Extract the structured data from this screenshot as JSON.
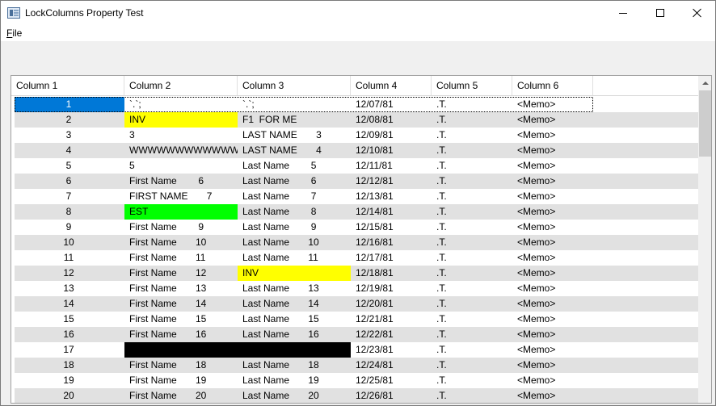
{
  "window": {
    "title": "LockColumns Property Test",
    "menu": [
      {
        "label": "File",
        "accelerator": "F",
        "rest": "ile"
      }
    ]
  },
  "grid": {
    "columns": [
      "Column 1",
      "Column 2",
      "Column 3",
      "Column 4",
      "Column 5",
      "Column 6"
    ],
    "highlight_colors": {
      "yellow": "#ffff00",
      "green": "#00ff00",
      "black": "#000000",
      "selection": "#0078d7"
    },
    "rows": [
      {
        "c1": "1",
        "c2": "`.`;",
        "c3": "`.`;",
        "c4": "12/07/81",
        "c5": ".T.",
        "c6": "<Memo>",
        "selected": true
      },
      {
        "c1": "2",
        "c2": "INV",
        "c3": "F1  FOR ME",
        "c4": "12/08/81",
        "c5": ".T.",
        "c6": "<Memo>",
        "c2_bg": "yellow"
      },
      {
        "c1": "3",
        "c2": "3",
        "c3": "LAST NAME       3",
        "c4": "12/09/81",
        "c5": ".T.",
        "c6": "<Memo>"
      },
      {
        "c1": "4",
        "c2": "WWWWWWWWWWWW...",
        "c3": "LAST NAME       4",
        "c4": "12/10/81",
        "c5": ".T.",
        "c6": "<Memo>"
      },
      {
        "c1": "5",
        "c2": "5",
        "c3": "Last Name        5",
        "c4": "12/11/81",
        "c5": ".T.",
        "c6": "<Memo>"
      },
      {
        "c1": "6",
        "c2": "First Name        6",
        "c3": "Last Name        6",
        "c4": "12/12/81",
        "c5": ".T.",
        "c6": "<Memo>"
      },
      {
        "c1": "7",
        "c2": "FIRST NAME       7",
        "c3": "Last Name        7",
        "c4": "12/13/81",
        "c5": ".T.",
        "c6": "<Memo>"
      },
      {
        "c1": "8",
        "c2": "EST",
        "c3": "Last Name        8",
        "c4": "12/14/81",
        "c5": ".T.",
        "c6": "<Memo>",
        "c2_bg": "green"
      },
      {
        "c1": "9",
        "c2": "First Name        9",
        "c3": "Last Name        9",
        "c4": "12/15/81",
        "c5": ".T.",
        "c6": "<Memo>"
      },
      {
        "c1": "10",
        "c2": "First Name       10",
        "c3": "Last Name       10",
        "c4": "12/16/81",
        "c5": ".T.",
        "c6": "<Memo>"
      },
      {
        "c1": "11",
        "c2": "First Name       11",
        "c3": "Last Name       11",
        "c4": "12/17/81",
        "c5": ".T.",
        "c6": "<Memo>"
      },
      {
        "c1": "12",
        "c2": "First Name       12",
        "c3": "INV",
        "c4": "12/18/81",
        "c5": ".T.",
        "c6": "<Memo>",
        "c3_bg": "yellow"
      },
      {
        "c1": "13",
        "c2": "First Name       13",
        "c3": "Last Name       13",
        "c4": "12/19/81",
        "c5": ".T.",
        "c6": "<Memo>"
      },
      {
        "c1": "14",
        "c2": "First Name       14",
        "c3": "Last Name       14",
        "c4": "12/20/81",
        "c5": ".T.",
        "c6": "<Memo>"
      },
      {
        "c1": "15",
        "c2": "First Name       15",
        "c3": "Last Name       15",
        "c4": "12/21/81",
        "c5": ".T.",
        "c6": "<Memo>"
      },
      {
        "c1": "16",
        "c2": "First Name       16",
        "c3": "Last Name       16",
        "c4": "12/22/81",
        "c5": ".T.",
        "c6": "<Memo>"
      },
      {
        "c1": "17",
        "c2": "",
        "c3": "",
        "c4": "12/23/81",
        "c5": ".T.",
        "c6": "<Memo>",
        "c2_bg": "black",
        "c3_bg": "black"
      },
      {
        "c1": "18",
        "c2": "First Name       18",
        "c3": "Last Name       18",
        "c4": "12/24/81",
        "c5": ".T.",
        "c6": "<Memo>"
      },
      {
        "c1": "19",
        "c2": "First Name       19",
        "c3": "Last Name       19",
        "c4": "12/25/81",
        "c5": ".T.",
        "c6": "<Memo>"
      },
      {
        "c1": "20",
        "c2": "First Name       20",
        "c3": "Last Name       20",
        "c4": "12/26/81",
        "c5": ".T.",
        "c6": "<Memo>"
      }
    ]
  }
}
